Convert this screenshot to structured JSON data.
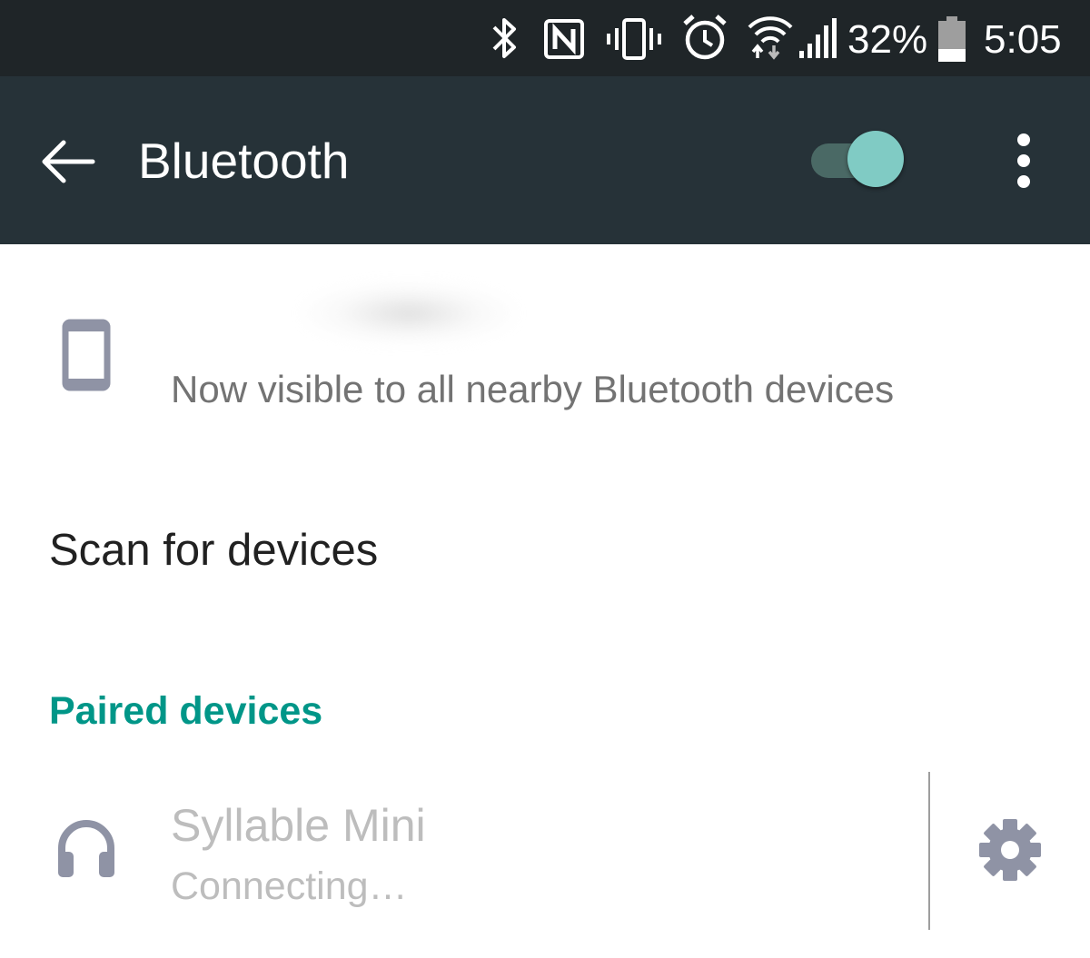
{
  "status_bar": {
    "icons": [
      "bluetooth-icon",
      "nfc-icon",
      "vibrate-icon",
      "alarm-icon",
      "wifi-icon",
      "cell-signal-icon",
      "battery-icon"
    ],
    "battery_percent": "32%",
    "time": "5:05",
    "battery_level": 0.32
  },
  "toolbar": {
    "title": "Bluetooth",
    "toggle_on": true
  },
  "device": {
    "visibility_text": "Now visible to all nearby Bluetooth devices"
  },
  "scan": {
    "label": "Scan for devices"
  },
  "paired": {
    "header": "Paired devices",
    "items": [
      {
        "name": "Syllable Mini",
        "status": "Connecting…",
        "icon": "headphones-icon"
      }
    ]
  },
  "colors": {
    "status_bar": "#1f2528",
    "toolbar": "#263238",
    "accent": "#009688",
    "toggle_thumb": "#80cbc4",
    "icon_gray": "#8f93a5"
  }
}
